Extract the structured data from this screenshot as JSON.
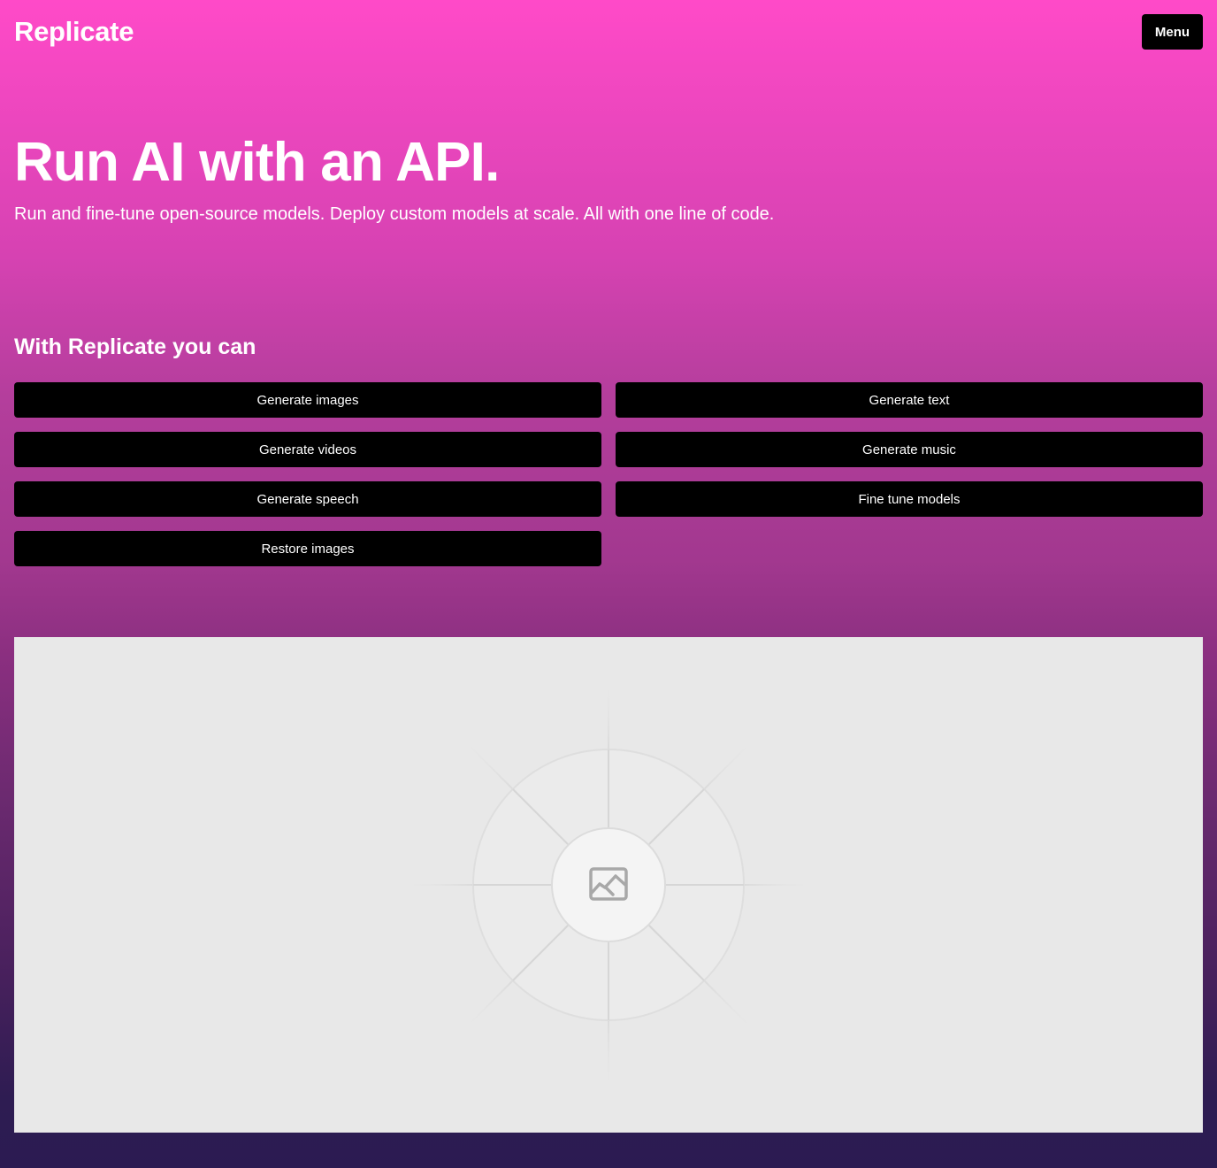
{
  "header": {
    "logo": "Replicate",
    "menu_label": "Menu"
  },
  "hero": {
    "title": "Run AI with an API.",
    "subtitle": "Run and fine-tune open-source models. Deploy custom models at scale. All with one line of code."
  },
  "capabilities": {
    "heading": "With Replicate you can",
    "items": [
      "Generate images",
      "Generate text",
      "Generate videos",
      "Generate music",
      "Generate speech",
      "Fine tune models",
      "Restore images"
    ]
  },
  "media": {
    "icon": "image-icon"
  },
  "colors": {
    "gradient_top": "#ff4ac8",
    "gradient_bottom": "#2b1b52",
    "button_bg": "#000000",
    "placeholder_bg": "#e8e8e8"
  }
}
